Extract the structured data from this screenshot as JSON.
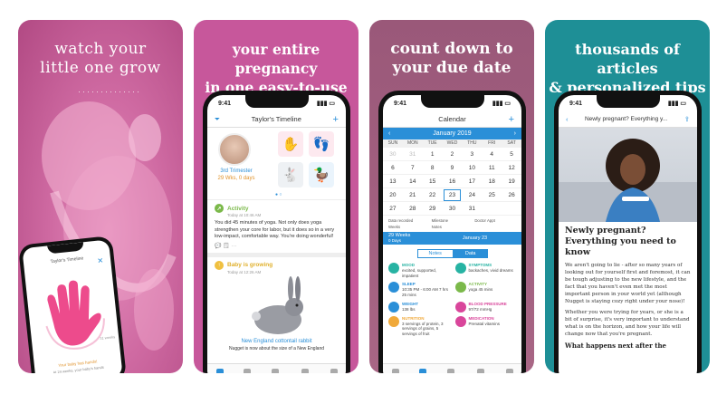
{
  "panels": [
    {
      "headline_1": "watch your",
      "headline_2": "little one grow"
    },
    {
      "headline_1": "your entire pregnancy",
      "headline_2": "in one easy-to-use app"
    },
    {
      "headline_1": "count down to",
      "headline_2": "your due date"
    },
    {
      "headline_1": "thousands of articles",
      "headline_2": "& personalized tips"
    }
  ],
  "status_time": "9:41",
  "phone1": {
    "title": "Taylor's Timeline",
    "caption_1": "Your baby has hands!",
    "caption_2": "At 24 weeks, your baby's hands",
    "badge": "31 weeks"
  },
  "timeline": {
    "title": "Taylor's Timeline",
    "trimester": "3rd Trimester",
    "weeks": "29 Wks, 0 days",
    "activity_title": "Activity",
    "activity_sub": "Today at 10:46 AM",
    "activity_text": "You did 45 minutes of yoga. Not only does yoga strengthen your core for labor, but it does so in a very low-impact, comfortable way. You're doing wonderful!",
    "growing_title": "Baby is growing",
    "growing_sub": "Today at 12:26 AM",
    "animal_name": "New England cottontail rabbit",
    "animal_text": "Nugget is now about the size of a New England"
  },
  "calendar": {
    "title": "Calendar",
    "month": "January 2019",
    "days_of_week": [
      "SUN",
      "MON",
      "TUE",
      "WED",
      "THU",
      "FRI",
      "SAT"
    ],
    "weeks": [
      [
        "30",
        "31",
        "1",
        "2",
        "3",
        "4",
        "5"
      ],
      [
        "6",
        "7",
        "8",
        "9",
        "10",
        "11",
        "12"
      ],
      [
        "13",
        "14",
        "15",
        "16",
        "17",
        "18",
        "19"
      ],
      [
        "20",
        "21",
        "22",
        "23",
        "24",
        "25",
        "26"
      ],
      [
        "27",
        "28",
        "29",
        "30",
        "31",
        "",
        ""
      ]
    ],
    "legend": [
      "Data recorded",
      "Milestone",
      "Doctor Appt",
      "Weeks",
      "Notes",
      ""
    ],
    "weeks_label": "29 Weeks",
    "weeks_sub": "0 Days",
    "selected_date": "January 23",
    "tab_notes": "Notes",
    "tab_data": "Data",
    "entries": [
      {
        "label": "MOOD",
        "text": "excited, supported, impatient",
        "color": "#27b3a3"
      },
      {
        "label": "SYMPTOMS",
        "text": "backaches, vivid dreams",
        "color": "#27b3a3"
      },
      {
        "label": "SLEEP",
        "text": "10:35 PM - 6:00 AM 7 hrs 25 mins",
        "color": "#2a8fd8"
      },
      {
        "label": "ACTIVITY",
        "text": "yoga 45 mins",
        "color": "#7bb94a"
      },
      {
        "label": "WEIGHT",
        "text": "138 lbs",
        "color": "#2a8fd8"
      },
      {
        "label": "BLOOD PRESSURE",
        "text": "97/72 mmHg",
        "color": "#d9469b"
      },
      {
        "label": "NUTRITION",
        "text": "3 servings of protein, 3 servings of grains, 5 servings of fruit",
        "color": "#f0a93a"
      },
      {
        "label": "MEDICATION",
        "text": "Prenatal vitamins",
        "color": "#d9469b"
      }
    ]
  },
  "article": {
    "nav_title": "Newly pregnant? Everything y...",
    "title": "Newly pregnant? Everything you need to know",
    "para_1": "We aren't going to lie - after so many years of looking out for yourself first and foremost, it can be tough adjusting to the new lifestyle, and the fact that you haven't even met the most important person in your world yet (although Nugget is staying cozy right under your nose)!",
    "para_2": "Whether you were trying for years, or she is a bit of surprise, it's very important to understand what is on the horizon, and how your life will change now that you're pregnant.",
    "subheading": "What happens next after the"
  },
  "tabs": [
    "home",
    "calendar",
    "health",
    "community",
    "more"
  ],
  "colors": {
    "pink_panel": "#c7579b",
    "mauve_panel": "#9a5879",
    "teal_panel": "#1e8f96",
    "accent_blue": "#2a8fd8"
  }
}
